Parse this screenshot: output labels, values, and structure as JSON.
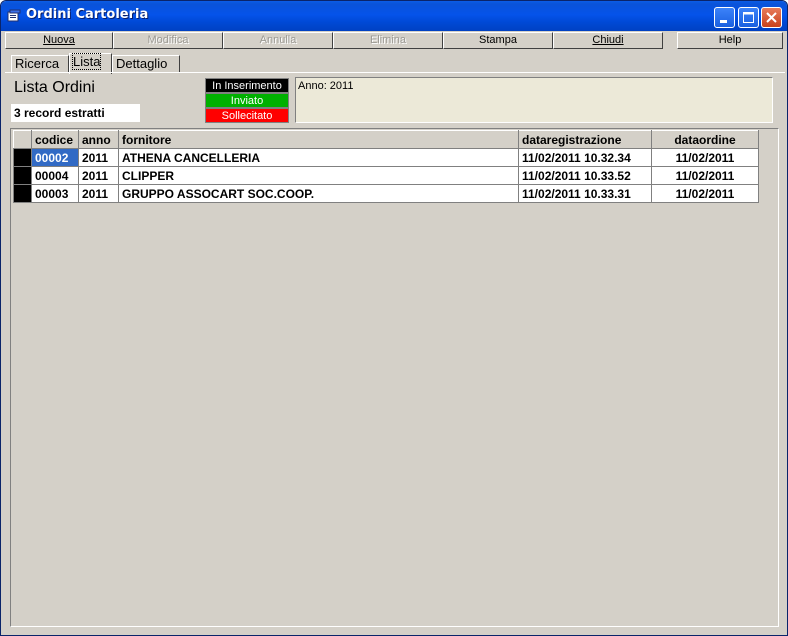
{
  "window": {
    "title": "Ordini Cartoleria"
  },
  "menu": [
    {
      "label": "Nuova",
      "enabled": true
    },
    {
      "label": "Modifica",
      "enabled": false
    },
    {
      "label": "Annulla",
      "enabled": false
    },
    {
      "label": "Elimina",
      "enabled": false
    },
    {
      "label": "Stampa",
      "enabled": true
    },
    {
      "label": "Chiudi",
      "enabled": true
    },
    {
      "label": "Help",
      "enabled": true
    }
  ],
  "tabs": [
    {
      "label": "Ricerca"
    },
    {
      "label": "Lista"
    },
    {
      "label": "Dettaglio"
    }
  ],
  "list": {
    "title": "Lista Ordini",
    "record_count": "3 record estratti"
  },
  "legend": [
    {
      "label": "In Inserimento",
      "color": "#000000"
    },
    {
      "label": "Inviato",
      "color": "#00b000"
    },
    {
      "label": "Sollecitato",
      "color": "#ff0000"
    }
  ],
  "filter_text": "Anno: 2011",
  "table": {
    "columns": [
      "codice",
      "anno",
      "fornitore",
      "dataregistrazione",
      "dataordine"
    ],
    "rows": [
      [
        "00002",
        "2011",
        "ATHENA CANCELLERIA",
        "11/02/2011 10.32.34",
        "11/02/2011"
      ],
      [
        "00004",
        "2011",
        "CLIPPER",
        "11/02/2011 10.33.52",
        "11/02/2011"
      ],
      [
        "00003",
        "2011",
        "GRUPPO ASSOCART SOC.COOP.",
        "11/02/2011 10.33.31",
        "11/02/2011"
      ]
    ]
  }
}
